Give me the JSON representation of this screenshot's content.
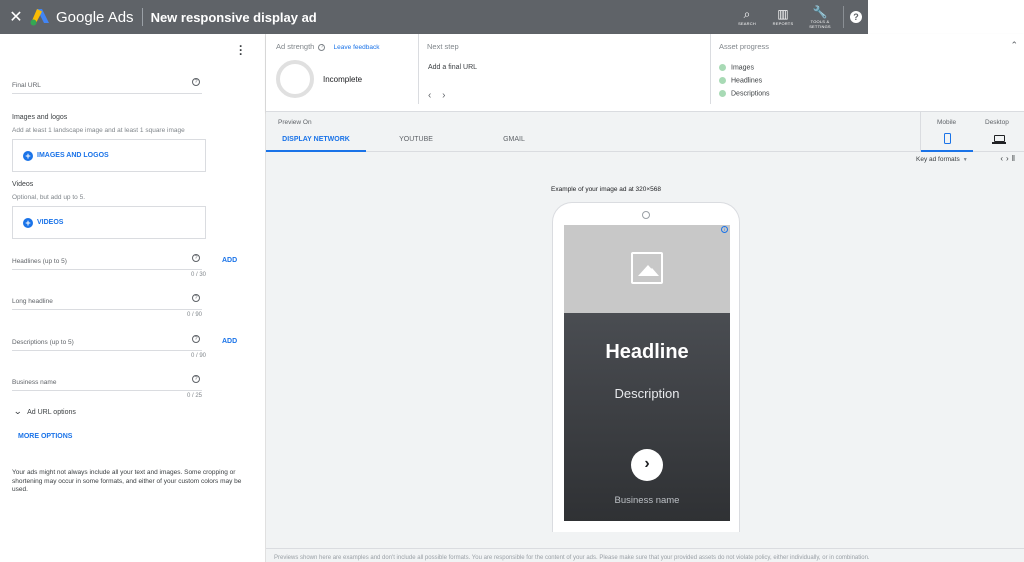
{
  "header": {
    "close_label": "✕",
    "brand": "Google Ads",
    "title": "New responsive display ad",
    "tools": [
      {
        "icon": "search-icon",
        "glyph": "⌕",
        "label": "SEARCH"
      },
      {
        "icon": "reports-icon",
        "glyph": "▥",
        "label": "REPORTS"
      },
      {
        "icon": "wrench-icon",
        "glyph": "🔧",
        "label1": "TOOLS &",
        "label2": "SETTINGS"
      }
    ],
    "help_glyph": "?"
  },
  "left": {
    "final_url_label": "Final URL",
    "images_title": "Images and logos",
    "images_sub": "Add at least 1 landscape image and at least 1 square image",
    "images_button": "IMAGES AND LOGOS",
    "videos_title": "Videos",
    "videos_sub": "Optional, but add up to 5.",
    "videos_button": "VIDEOS",
    "headlines_label": "Headlines (up to 5)",
    "headlines_count": "0 / 30",
    "long_headline_label": "Long headline",
    "long_headline_count": "0 / 90",
    "descriptions_label": "Descriptions (up to 5)",
    "descriptions_count": "0 / 90",
    "business_label": "Business name",
    "business_count": "0 / 25",
    "add_label": "ADD",
    "ad_url_options": "Ad URL options",
    "more_options": "MORE OPTIONS",
    "note": "Your ads might not always include all your text and images. Some cropping or shortening may occur in some formats, and either of your custom colors may be used."
  },
  "info": {
    "ad_strength_label": "Ad strength",
    "leave_feedback": "Leave feedback",
    "strength_value": "Incomplete",
    "next_step_label": "Next step",
    "next_step_value": "Add a final URL",
    "asset_progress_label": "Asset progress",
    "progress_items": [
      "Images",
      "Headlines",
      "Descriptions"
    ],
    "progress_color": "#a8dab5"
  },
  "preview": {
    "preview_on": "Preview On",
    "tabs": [
      "DISPLAY NETWORK",
      "YOUTUBE",
      "GMAIL"
    ],
    "active_tab": "DISPLAY NETWORK",
    "mobile_label": "Mobile",
    "desktop_label": "Desktop",
    "key_formats": "Key ad formats",
    "example_label": "Example of your image ad at 320×568",
    "ad": {
      "headline": "Headline",
      "description": "Description",
      "business_name": "Business name"
    },
    "footer_note": "Previews shown here are examples and don't include all possible formats. You are responsible for the content of your ads. Please make sure that your provided assets do not violate policy, either individually, or in combination."
  },
  "colors": {
    "accent": "#1a73e8",
    "topbar": "#5f6368"
  }
}
